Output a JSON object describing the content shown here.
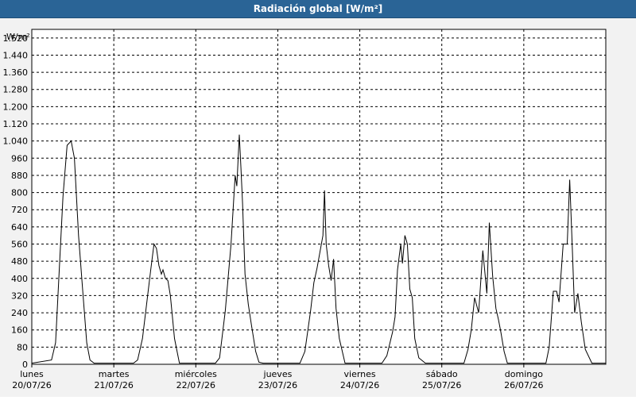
{
  "window": {
    "title": "Radiación global [W/m²]"
  },
  "chart_data": {
    "type": "line",
    "title": "Radiación global [W/m²]",
    "ylabel": "W/m²",
    "ylim": [
      0,
      1560
    ],
    "yticks": [
      80,
      160,
      240,
      320,
      400,
      480,
      560,
      640,
      720,
      800,
      880,
      960,
      1040,
      1120,
      1200,
      1280,
      1360,
      1440,
      1520
    ],
    "ytick_labels": [
      "80",
      "160",
      "240",
      "320",
      "400",
      "480",
      "560",
      "640",
      "720",
      "800",
      "880",
      "960",
      "1.040",
      "1.120",
      "1.200",
      "1.280",
      "1.360",
      "1.440",
      "1.520"
    ],
    "y_zero_label": "0",
    "xlim": [
      0,
      7
    ],
    "days": [
      {
        "day": "lunes",
        "date": "20/07/26"
      },
      {
        "day": "martes",
        "date": "21/07/26"
      },
      {
        "day": "miércoles",
        "date": "22/07/26"
      },
      {
        "day": "jueves",
        "date": "23/07/26"
      },
      {
        "day": "viernes",
        "date": "24/07/26"
      },
      {
        "day": "sábado",
        "date": "25/07/26"
      },
      {
        "day": "domingo",
        "date": "26/07/26"
      }
    ],
    "grid": true,
    "line_color": "#000000",
    "series": [
      {
        "x": [
          0,
          0.24,
          0.29,
          0.33,
          0.38,
          0.43,
          0.48,
          0.52,
          0.57,
          0.62,
          0.67,
          0.71,
          0.76,
          0.82,
          1.24,
          1.29,
          1.35,
          1.4,
          1.45,
          1.49,
          1.52,
          1.55,
          1.58,
          1.6,
          1.63,
          1.66,
          1.69,
          1.74,
          1.8,
          2.24,
          2.29,
          2.36,
          2.43,
          2.48,
          2.5,
          2.53,
          2.55,
          2.57,
          2.6,
          2.64,
          2.68,
          2.73,
          2.77,
          2.82,
          3.27,
          3.33,
          3.4,
          3.44,
          3.48,
          3.55,
          3.57,
          3.59,
          3.62,
          3.65,
          3.68,
          3.71,
          3.75,
          3.82,
          4.27,
          4.33,
          4.4,
          4.43,
          4.46,
          4.5,
          4.52,
          4.55,
          4.58,
          4.61,
          4.64,
          4.67,
          4.72,
          4.8,
          5.27,
          5.32,
          5.36,
          5.4,
          5.45,
          5.5,
          5.55,
          5.58,
          5.62,
          5.66,
          5.69,
          5.72,
          5.76,
          5.8,
          6.27,
          6.31,
          6.36,
          6.4,
          6.43,
          6.48,
          6.53,
          6.56,
          6.59,
          6.62,
          6.66,
          6.7,
          6.75,
          6.83,
          7.0
        ],
        "y": [
          5,
          20,
          100,
          400,
          780,
          1020,
          1040,
          960,
          600,
          350,
          100,
          20,
          5,
          5,
          5,
          20,
          120,
          280,
          440,
          560,
          540,
          460,
          420,
          440,
          400,
          390,
          320,
          120,
          5,
          5,
          30,
          250,
          560,
          880,
          830,
          1070,
          920,
          750,
          420,
          280,
          180,
          60,
          10,
          5,
          5,
          60,
          250,
          380,
          450,
          600,
          810,
          560,
          460,
          390,
          490,
          260,
          120,
          5,
          5,
          40,
          150,
          220,
          440,
          560,
          470,
          600,
          560,
          350,
          310,
          120,
          30,
          5,
          5,
          70,
          160,
          310,
          240,
          530,
          330,
          660,
          410,
          260,
          210,
          150,
          60,
          5,
          5,
          80,
          340,
          340,
          290,
          560,
          560,
          860,
          560,
          240,
          330,
          200,
          70,
          5,
          5
        ]
      }
    ]
  }
}
